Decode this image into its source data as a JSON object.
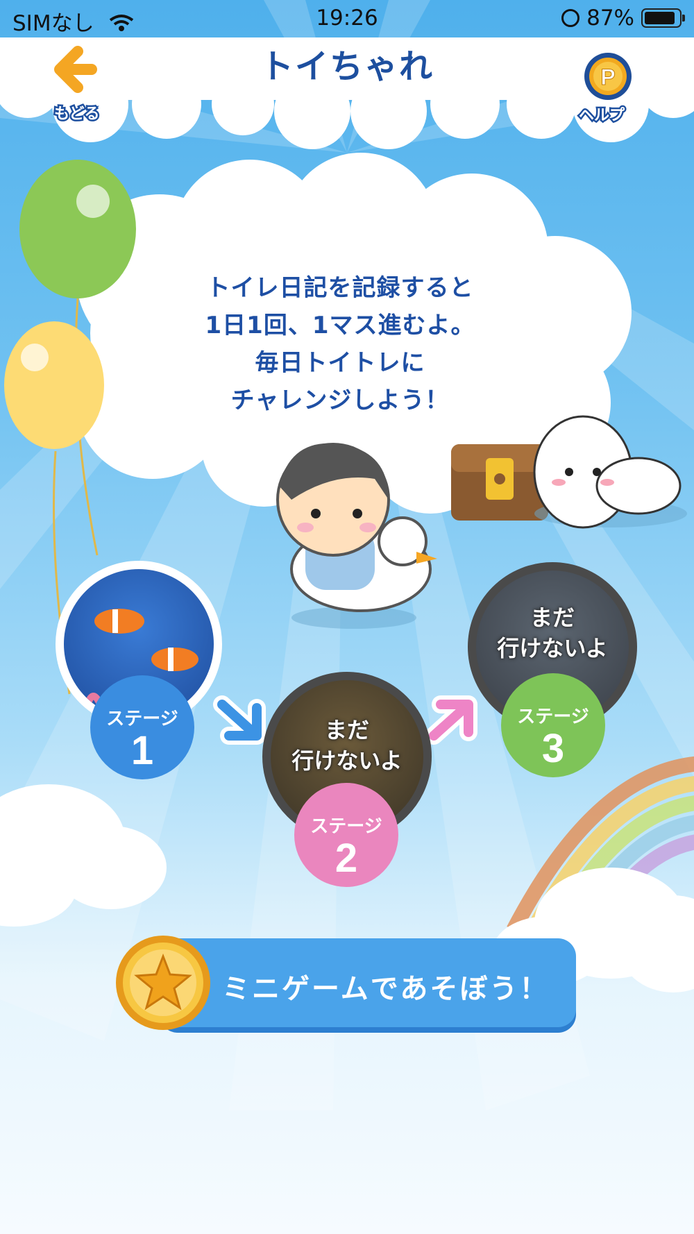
{
  "status_bar": {
    "carrier": "SIMなし",
    "time": "19:26",
    "battery": "87%"
  },
  "header": {
    "title": "トイちゃれ",
    "back_label": "もどる",
    "help_label": "ヘルプ",
    "help_coin": "P"
  },
  "message": {
    "lines": [
      "トイレ日記を記録すると",
      "1日1回、1マス進むよ。",
      "毎日トイトレに",
      "チャレンジしよう！"
    ]
  },
  "stages": [
    {
      "label": "ステージ",
      "number": "1",
      "status": "",
      "color": "#3a8de0"
    },
    {
      "label": "ステージ",
      "number": "2",
      "status_lines": [
        "まだ",
        "行けないよ"
      ],
      "color": "#ea86be"
    },
    {
      "label": "ステージ",
      "number": "3",
      "status_lines": [
        "まだ",
        "行けないよ"
      ],
      "color": "#7ec458"
    }
  ],
  "minigame": {
    "label": "ミニゲームであそぼう！"
  },
  "colors": {
    "title": "#1d4f9f",
    "sky": "#4fb0ec",
    "button": "#4aa3ea"
  }
}
